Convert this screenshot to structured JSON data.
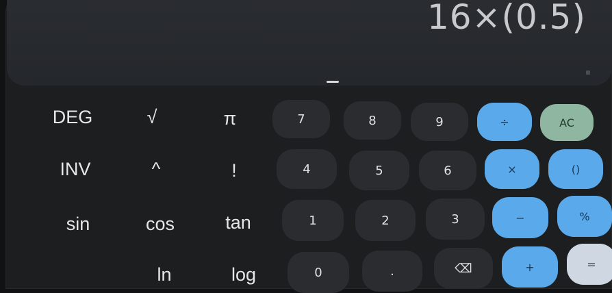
{
  "display": {
    "expression": "16×(0.5)"
  },
  "scientific": {
    "row1": [
      "DEG",
      "√",
      "π"
    ],
    "row2": [
      "INV",
      "^",
      "!"
    ],
    "row3": [
      "sin",
      "cos",
      "tan"
    ],
    "row4": [
      "",
      "ln",
      "log"
    ]
  },
  "keypad": {
    "seven": "7",
    "eight": "8",
    "nine": "9",
    "divide": "÷",
    "clear": "AC",
    "four": "4",
    "five": "5",
    "six": "6",
    "multiply": "×",
    "parens": "()",
    "one": "1",
    "two": "2",
    "three": "3",
    "minus": "−",
    "percent": "%",
    "zero": "0",
    "point": ".",
    "backspace": "⌫",
    "plus": "+",
    "equals": "="
  },
  "colors": {
    "background": "#1d1e20",
    "display": "#26292d",
    "number_key": "#2b2c2f",
    "operator_key": "#5aa9ea",
    "clear_key": "#8fb6a0",
    "equals_key": "#cfd8e2"
  }
}
